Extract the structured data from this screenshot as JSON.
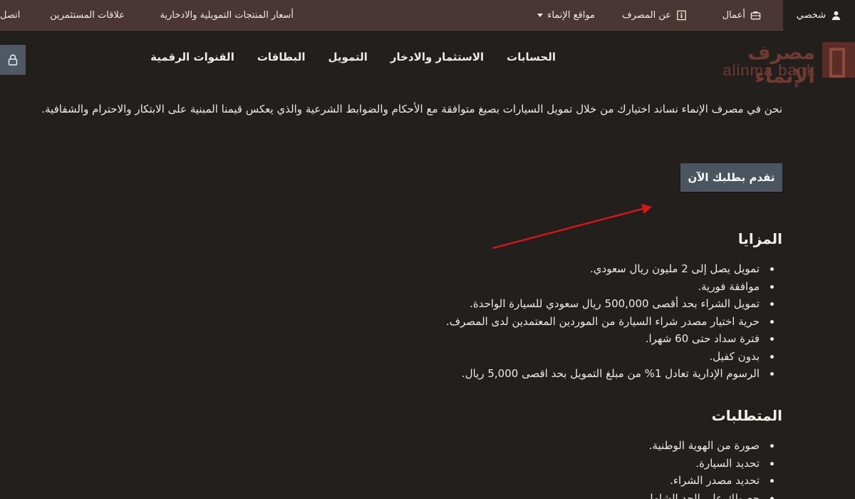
{
  "topbar": {
    "personal": "شخصي",
    "business": "أعمال",
    "about": "عن المصرف",
    "alinma_sites": "مواقع الإنماء",
    "prices": "أسعار المنتجات التمويلية والادخارية",
    "investor_relations": "علاقات المستثمرين",
    "contact": "اتصل"
  },
  "logo": {
    "arabic": "مصرف الإنماء",
    "english": "alinma bank"
  },
  "nav": {
    "accounts": "الحسابات",
    "investment": "الاستثمار والادخار",
    "financing": "التمويل",
    "cards": "البطاقات",
    "digital": "القنوات الرقمية"
  },
  "intro": "نحن في مصرف الإنماء نساند اختيارك من خلال تمويل السيارات بصيغ متوافقة مع الأحكام والضوابط الشرعية والذي يعكس قيمنا المبنية على الابتكار والاحترام والشفافية.",
  "apply_button": "تقدم بطلبك الآن",
  "features": {
    "title": "المزايا",
    "items": [
      "تمويل يصل إلى 2 مليون ريال سعودي.",
      "موافقة فورية.",
      "تمويل الشراء بحد أقصى 500,000 ريال سعودي للسيارة الواحدة.",
      "حرية اختيار مصدر شراء السيارة من الموردين المعتمدين لدى المصرف.",
      "فترة سداد حتى 60 شهرا.",
      "بدون كفيل.",
      "الرسوم الإدارية تعادل 1% من مبلغ التمويل بحد اقصى 5,000 ريال."
    ]
  },
  "requirements": {
    "title": "المتطلبات",
    "items": [
      "صورة من الهوية الوطنية.",
      "تحديد السيارة.",
      "تحديد مصدر الشراء.",
      "حصولك على الحد الشامل."
    ]
  },
  "colors": {
    "background": "#231f1d",
    "topbar": "#4a3632",
    "button": "#4b5560",
    "arrow": "#d8161a",
    "logo": "#6f3a30"
  }
}
